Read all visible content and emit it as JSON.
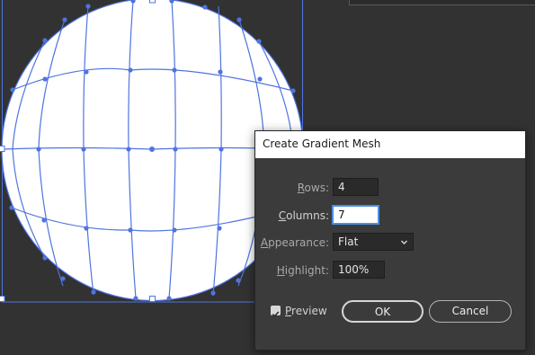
{
  "dialog": {
    "title": "Create Gradient Mesh",
    "rows": {
      "label": "Rows:",
      "label_key": "R",
      "label_rest": "ows:",
      "value": "4"
    },
    "columns": {
      "label": "Columns:",
      "label_key": "C",
      "label_rest": "olumns:",
      "value": "7"
    },
    "appearance": {
      "label": "Appearance:",
      "label_key": "A",
      "label_rest": "ppearance:",
      "value": "Flat"
    },
    "highlight": {
      "label": "Highlight:",
      "label_key": "H",
      "label_rest": "ighlight:",
      "value": "100%"
    },
    "preview": {
      "label": "Preview",
      "label_key": "P",
      "label_rest": "review",
      "checked": true
    },
    "buttons": {
      "ok": "OK",
      "cancel": "Cancel"
    }
  },
  "colors": {
    "canvas": "#323232",
    "mesh_line": "#4f74e0",
    "mesh_point": "#4f74e0",
    "dialog_bg": "#3b3b3b"
  },
  "icons": {
    "dropdown": "chevron-down-icon",
    "checkbox": "checkmark-icon"
  }
}
